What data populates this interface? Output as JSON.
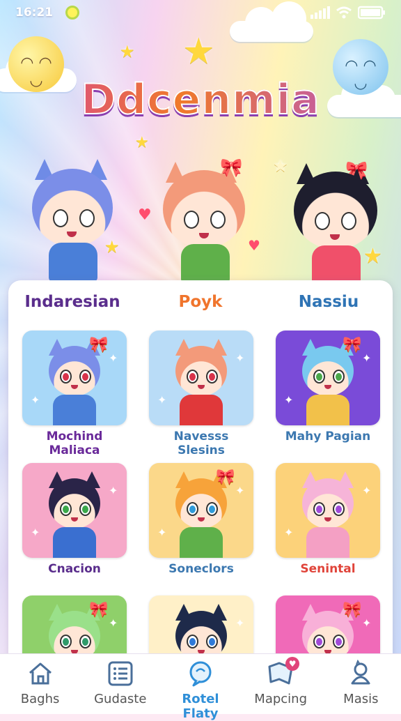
{
  "status": {
    "time": "16:21"
  },
  "app": {
    "title": "Ddcenmia"
  },
  "featured": [
    {
      "name": "Indaresian",
      "color": "#5a2d8c"
    },
    {
      "name": "Poyk",
      "color": "#f0752d"
    },
    {
      "name": "Nassiu",
      "color": "#2f74b5"
    }
  ],
  "cards": [
    {
      "caption": "Mochind Maliaca",
      "caption_color": "#6a2a9a",
      "bg": "#a8d8f8",
      "hair": "#7b8ee8",
      "eye": "#d8334a",
      "shirt": "#4a7fd8"
    },
    {
      "caption": "Navesss Slesins",
      "caption_color": "#3c78b0",
      "bg": "#b9dcf7",
      "hair": "#f39a7a",
      "eye": "#d8334a",
      "shirt": "#e0383a"
    },
    {
      "caption": "Mahy Pagian",
      "caption_color": "#3c78b0",
      "bg": "#7a4bd8",
      "hair": "#79c9ef",
      "eye": "#4aa84a",
      "shirt": "#f2c14a"
    },
    {
      "caption": "Cnacion",
      "caption_color": "#5a2d8c",
      "bg": "#f6a8c8",
      "hair": "#2a2448",
      "eye": "#3aa84a",
      "shirt": "#3a6fd0"
    },
    {
      "caption": "Soneclors",
      "caption_color": "#3c78b0",
      "bg": "#fbd88a",
      "hair": "#f7a33a",
      "eye": "#2f9ad8",
      "shirt": "#5fb04a"
    },
    {
      "caption": "Senintal",
      "caption_color": "#e0443a",
      "bg": "#fcd27a",
      "hair": "#f6b4d8",
      "eye": "#a04ad8",
      "shirt": "#f4a0c4"
    },
    {
      "caption": "",
      "caption_color": "#333",
      "bg": "#8fd06a",
      "hair": "#9ae08a",
      "eye": "#2f9a6a",
      "shirt": "#4aa04a"
    },
    {
      "caption": "",
      "caption_color": "#333",
      "bg": "#fff0c8",
      "hair": "#1e2a4a",
      "eye": "#2f7ad8",
      "shirt": "#e05a3a"
    },
    {
      "caption": "",
      "caption_color": "#333",
      "bg": "#f06ab8",
      "hair": "#f8b0d8",
      "eye": "#a04ad8",
      "shirt": "#f47ab0"
    }
  ],
  "nav": [
    {
      "label": "Baghs",
      "icon": "home-icon"
    },
    {
      "label": "Gudaste",
      "icon": "list-icon"
    },
    {
      "label": "Rotel Flaty",
      "icon": "chat-search-icon"
    },
    {
      "label": "Mapcing",
      "icon": "map-icon",
      "badge": "♥"
    },
    {
      "label": "Masis",
      "icon": "character-icon"
    }
  ]
}
